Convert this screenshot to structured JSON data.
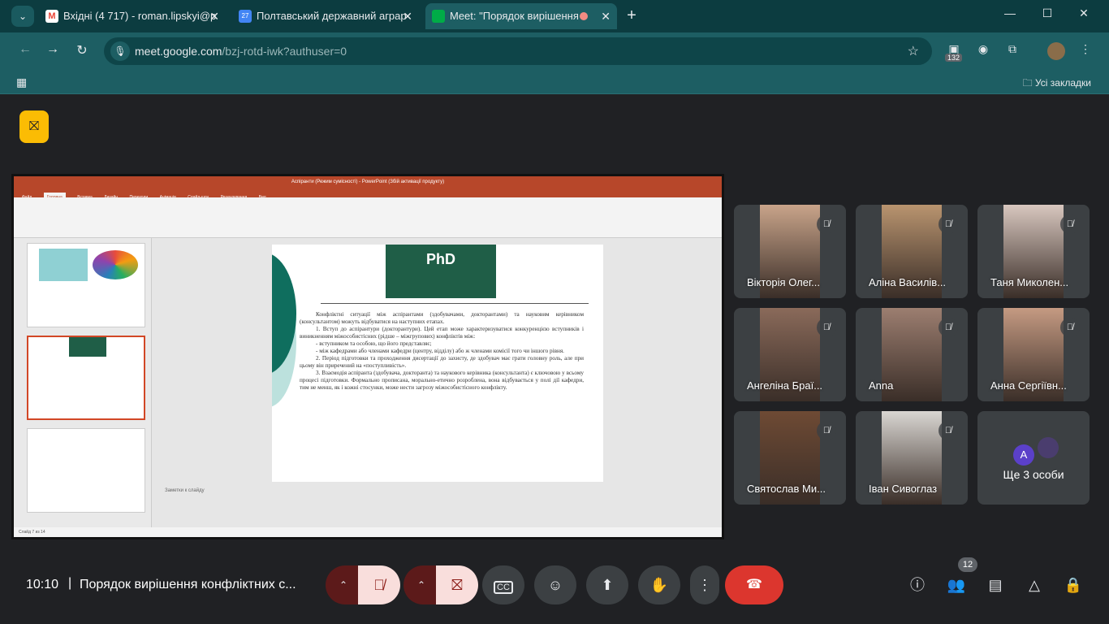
{
  "browser": {
    "tabs": [
      {
        "title": "Вхідні (4 717) - roman.lipskyi@p",
        "favicon_color": "#ea4335"
      },
      {
        "title": "Полтавський державний аграр",
        "favicon_color": "#4285f4"
      },
      {
        "title": "Meet: \"Порядок вирішення",
        "favicon_color": "#00ac47"
      }
    ],
    "url_host": "meet.google.com",
    "url_path": "/bzj-rotd-iwk?authuser=0",
    "extension_badge": "132",
    "bookmarks_all": "Усі закладки",
    "calendar_day": "27"
  },
  "presentation": {
    "app_title": "Аспіранти (Режим сумісності) - PowerPoint (Збій активації продукту)",
    "ribbon_tabs": [
      "Файл",
      "Головна",
      "Вставка",
      "Дизайн",
      "Переходи",
      "Анімація",
      "Слайд-шоу",
      "Рецензування",
      "Вид"
    ],
    "slide_badge": "PhD",
    "slide_paragraphs": [
      "Конфліктні ситуації між аспірантами (здобувачами, докторантами) та науковим керівником (консультантом) можуть відбуватися на наступних етапах.",
      "1. Вступ до аспірантури (докторантури). Цей етап може характеризуватися конкуренцією вступників і виникненням міжособистісних (рідше – міжгрупових) конфліктів між:",
      "- вступником та особою, що його представляє;",
      "- між кафедрами або членами кафедри (центру, відділу) або ж членами комісії того чи іншого рівня.",
      "2. Період підготовки та проходження дисертації до захисту, де здобувач має грати головну роль, але при цьому він приречений на «поступливість».",
      "3. Взаємодія аспіранта (здобувача, докторанта) та наукового керівника (консультанта) є ключовою у всьому процесі підготовки. Формально прописана, морально-етично розроблена, вона відбувається у полі дії кафедри, тим не менш, як і кожні стосунки, може нести загрозу міжособистісного конфлікту."
    ],
    "notes_placeholder": "Заметки к слайду",
    "status_text": "Слайд 7 из 14"
  },
  "participants": [
    {
      "name": "Вікторія Олег...",
      "bg": "#c9a48a",
      "muted": true
    },
    {
      "name": "Аліна Василів...",
      "bg": "#b9946f",
      "muted": true
    },
    {
      "name": "Таня Миколен...",
      "bg": "#d8c7bf",
      "muted": true
    },
    {
      "name": "Ангеліна Браї...",
      "bg": "#8a6a5a",
      "muted": true
    },
    {
      "name": "Anna",
      "bg": "#9c7e70",
      "muted": true
    },
    {
      "name": "Анна Сергіївн...",
      "bg": "#c59a82",
      "muted": true
    },
    {
      "name": "Святослав Ми...",
      "bg": "#6e4a34",
      "muted": true
    },
    {
      "name": "Іван Сивоглаз",
      "bg": "#d9d6d2",
      "muted": true
    }
  ],
  "more_tile": {
    "label": "Ще 3 особи",
    "avatar_letter": "A",
    "avatar_color": "#5b40c9"
  },
  "bottom_bar": {
    "time": "10:10",
    "meeting_title": "Порядок вирішення конфліктних с...",
    "people_count": "12"
  },
  "colors": {
    "accent_red": "#dc362e",
    "rec_yellow": "#fbbc04",
    "chrome_teal": "#1d5e63"
  }
}
